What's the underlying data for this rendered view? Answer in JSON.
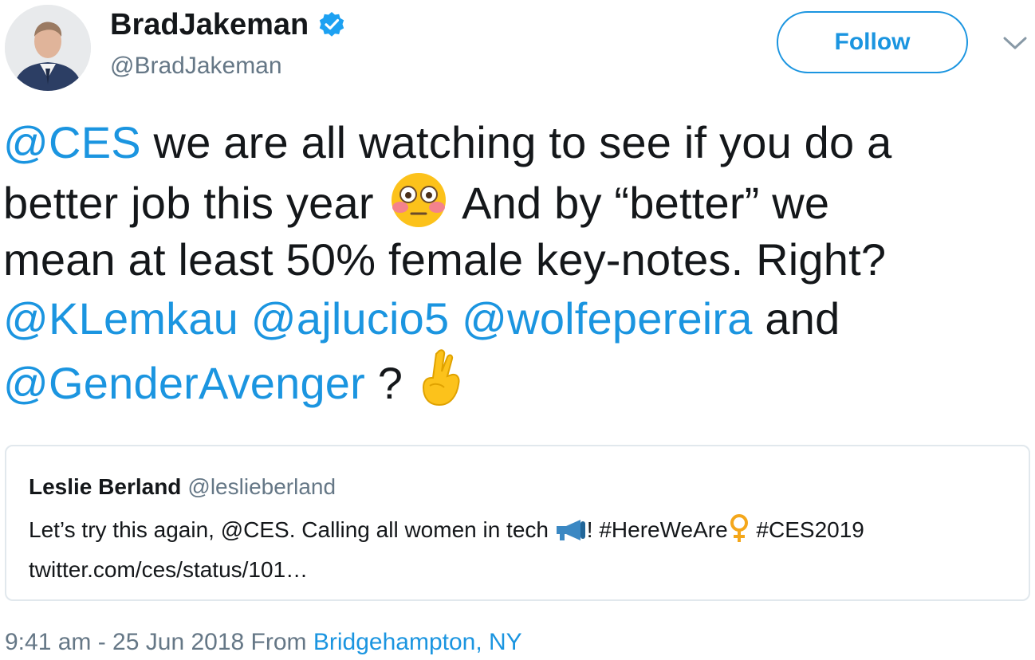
{
  "author": {
    "display_name": "BradJakeman",
    "handle": "@BradJakeman",
    "verified_icon": "verified-badge-icon",
    "avatar_icon": "avatar-photo"
  },
  "actions": {
    "follow_label": "Follow",
    "menu_icon": "chevron-down-icon"
  },
  "tweet": {
    "line1": {
      "mention": "@CES",
      "text": " we are all watching to see if you do a"
    },
    "line2": {
      "text_a": "better job this year ",
      "emoji": "flushed-face-emoji",
      "text_b": " And by “better” we"
    },
    "line3": {
      "text": "mean at least 50% female key-notes. Right?"
    },
    "line4": {
      "mention1": "@KLemkau",
      "mention2": "@ajlucio5",
      "mention3": "@wolfepereira",
      "text": " and"
    },
    "line5": {
      "mention": "@GenderAvenger",
      "text": " ? ",
      "emoji": "crossed-fingers-emoji"
    }
  },
  "quoted_tweet": {
    "name": "Leslie Berland",
    "handle": "@leslieberland",
    "text_a": "Let’s try this again, @CES. Calling all women in tech ",
    "emoji1": "megaphone-emoji",
    "text_b": "! #HereWeAre",
    "emoji2": "female-sign-emoji",
    "text_c": " #CES2019",
    "link": "twitter.com/ces/status/101…"
  },
  "footer": {
    "timestamp": "9:41 am - 25 Jun 2018 From ",
    "location": "Bridgehampton, NY"
  },
  "colors": {
    "link_blue": "#1b95e0",
    "text": "#14171a",
    "secondary_text": "#657786",
    "border": "#e1e8ed"
  }
}
